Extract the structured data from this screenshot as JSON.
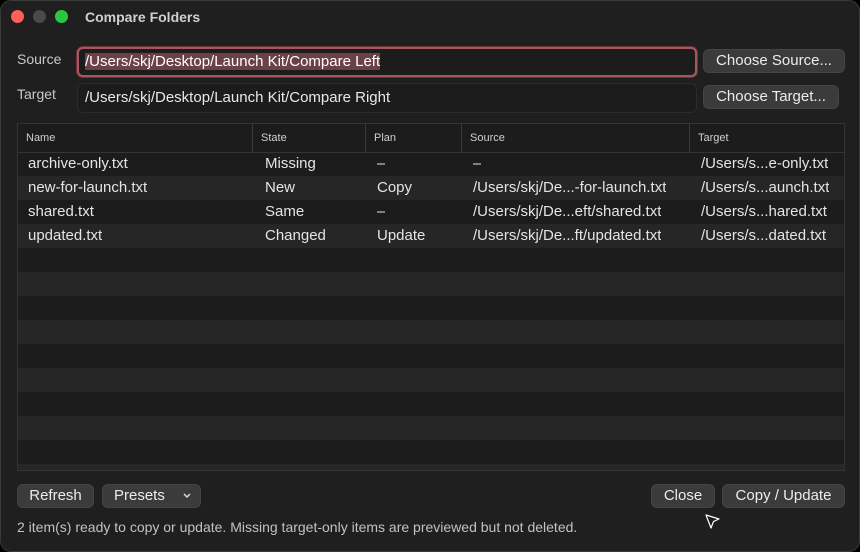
{
  "window": {
    "title": "Compare Folders"
  },
  "source": {
    "label": "Source",
    "value": "/Users/skj/Desktop/Launch Kit/Compare Left",
    "button": "Choose Source..."
  },
  "target": {
    "label": "Target",
    "value": "/Users/skj/Desktop/Launch Kit/Compare Right",
    "button": "Choose Target..."
  },
  "table": {
    "columns": [
      "Name",
      "State",
      "Plan",
      "Source",
      "Target"
    ],
    "rows": [
      {
        "name": "archive-only.txt",
        "state": "Missing",
        "plan": "–",
        "source": "–",
        "target": "/Users/s...e-only.txt"
      },
      {
        "name": "new-for-launch.txt",
        "state": "New",
        "plan": "Copy",
        "source": "/Users/skj/De...-for-launch.txt",
        "target": "/Users/s...aunch.txt"
      },
      {
        "name": "shared.txt",
        "state": "Same",
        "plan": "–",
        "source": "/Users/skj/De...eft/shared.txt",
        "target": "/Users/s...hared.txt"
      },
      {
        "name": "updated.txt",
        "state": "Changed",
        "plan": "Update",
        "source": "/Users/skj/De...ft/updated.txt",
        "target": "/Users/s...dated.txt"
      }
    ]
  },
  "toolbar": {
    "refresh": "Refresh",
    "presets": "Presets",
    "close": "Close",
    "copy_update": "Copy / Update"
  },
  "status": "2 item(s) ready to copy or update. Missing target-only items are previewed but not deleted.",
  "colors": {
    "window_bg": "#1f1f1f",
    "focus_ring": "#a5575f",
    "selection": "#6b4147",
    "close_light": "#fe5f57",
    "zoom_light": "#2ac840"
  }
}
